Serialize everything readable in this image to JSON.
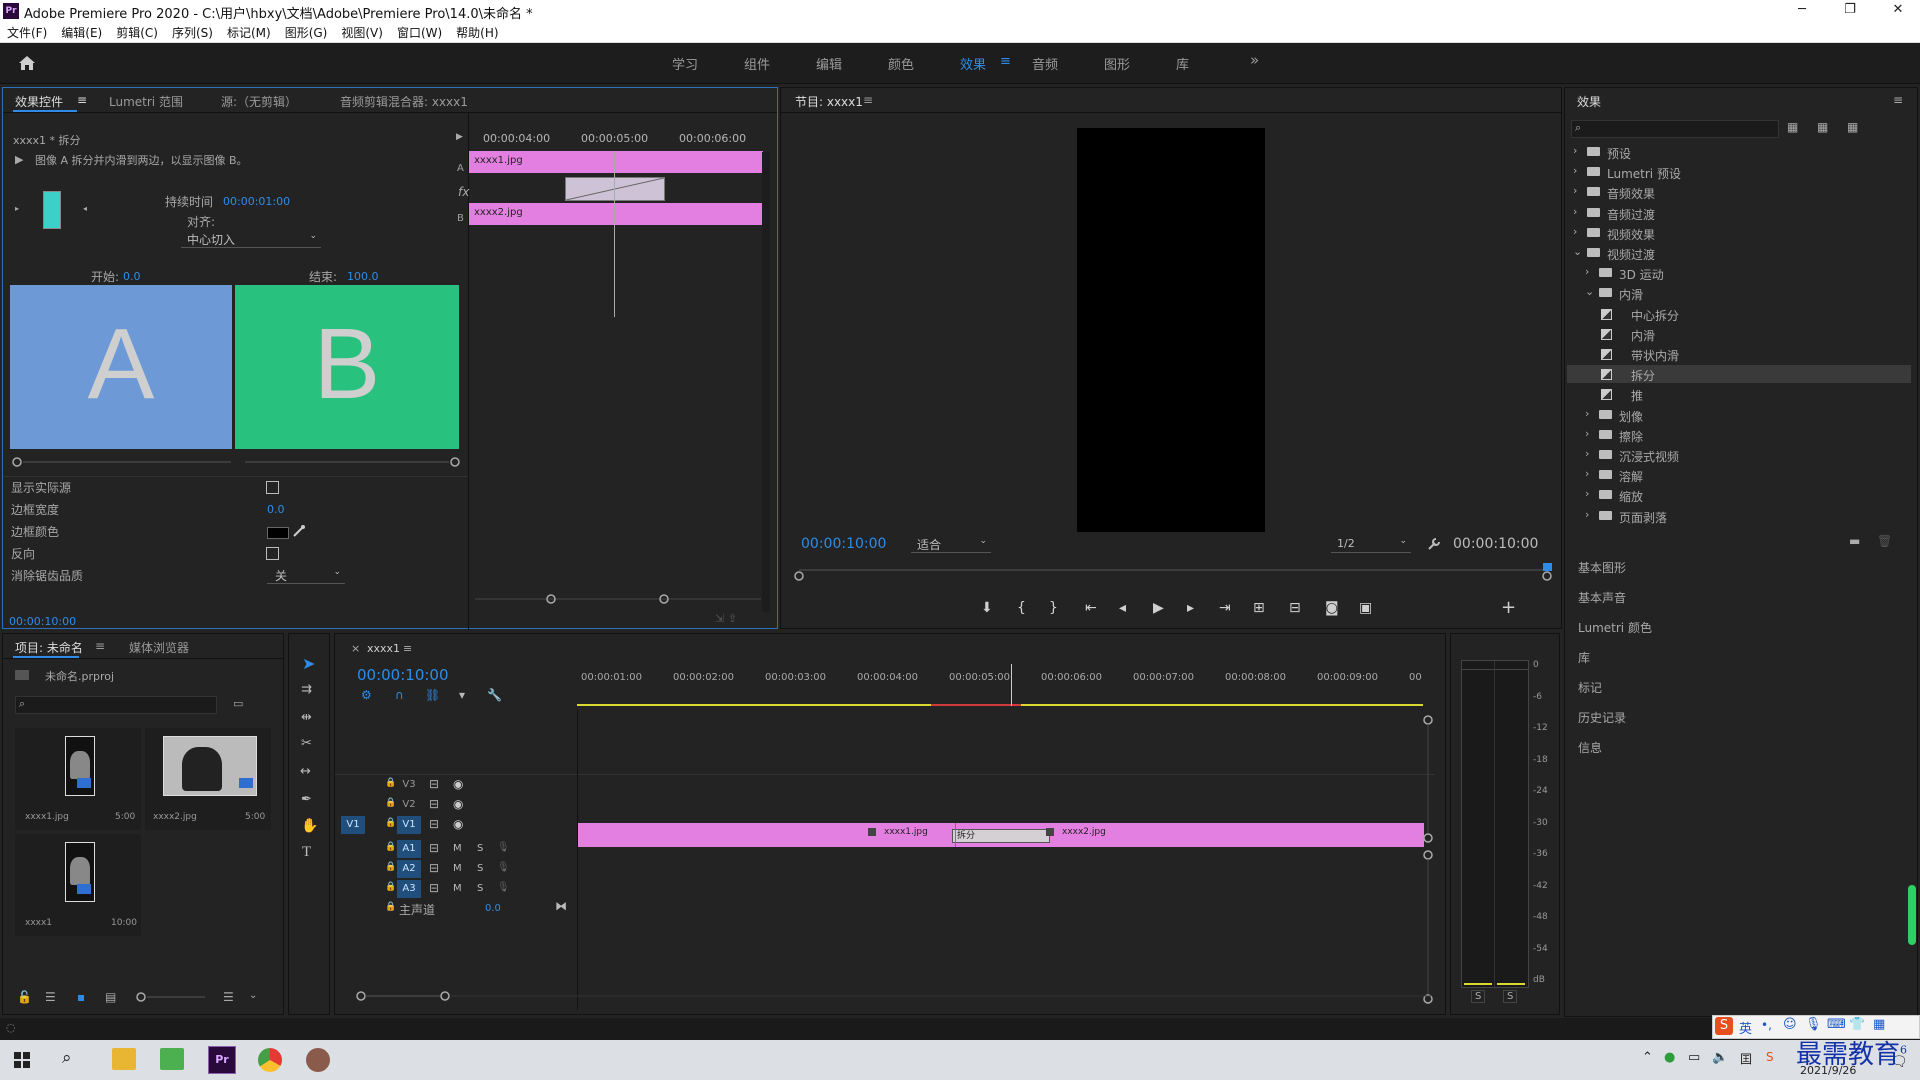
{
  "window": {
    "title": "Adobe Premiere Pro 2020 - C:\\用户\\hbxy\\文档\\Adobe\\Premiere Pro\\14.0\\未命名 *",
    "min": "─",
    "max": "❐",
    "close": "✕"
  },
  "menu": [
    "文件(F)",
    "编辑(E)",
    "剪辑(C)",
    "序列(S)",
    "标记(M)",
    "图形(G)",
    "视图(V)",
    "窗口(W)",
    "帮助(H)"
  ],
  "workspaces": [
    "学习",
    "组件",
    "编辑",
    "颜色",
    "效果",
    "音频",
    "图形",
    "库"
  ],
  "workspace_more": "»",
  "effect_controls": {
    "tabs": [
      "效果控件",
      "Lumetri 范围",
      "源:（无剪辑）",
      "音频剪辑混合器: xxxx1"
    ],
    "clip_label": "xxxx1 * 拆分",
    "description": "图像 A 拆分并内滑到两边，以显示图像 B。",
    "duration_label": "持续时间",
    "duration_value": "00:00:01:00",
    "align_label": "对齐:",
    "align_value": "中心切入",
    "start_label": "开始:",
    "start_value": "0.0",
    "end_label": "结束:",
    "end_value": "100.0",
    "letter_a": "A",
    "letter_b": "B",
    "timecodes": [
      "00:00:04:00",
      "00:00:05:00",
      "00:00:06:00"
    ],
    "track_a_clip": "xxxx1.jpg",
    "track_b_clip": "xxxx2.jpg",
    "track_a_label": "A",
    "track_b_label": "B",
    "fx_label": "fx",
    "props": [
      {
        "label": "显示实际源",
        "type": "checkbox"
      },
      {
        "label": "边框宽度",
        "type": "value",
        "value": "0.0"
      },
      {
        "label": "边框颜色",
        "type": "color"
      },
      {
        "label": "反向",
        "type": "checkbox"
      },
      {
        "label": "消除锯齿品质",
        "type": "dropdown",
        "value": "关"
      }
    ],
    "current_time": "00:00:10:00",
    "colors": {
      "a_tile": "#6d9ad6",
      "b_tile": "#29c17e",
      "clip": "#e37fe0"
    }
  },
  "program_monitor": {
    "tab": "节目: xxxx1",
    "timecode_left": "00:00:10:00",
    "fit": "适合",
    "resolution": "1/2",
    "timecode_right": "00:00:10:00"
  },
  "effects_panel": {
    "tab": "效果",
    "tree": [
      {
        "label": "预设",
        "level": 0,
        "type": "bin",
        "open": false
      },
      {
        "label": "Lumetri 预设",
        "level": 0,
        "type": "bin",
        "open": false
      },
      {
        "label": "音频效果",
        "level": 0,
        "type": "folder",
        "open": false
      },
      {
        "label": "音频过渡",
        "level": 0,
        "type": "folder",
        "open": false
      },
      {
        "label": "视频效果",
        "level": 0,
        "type": "folder",
        "open": false
      },
      {
        "label": "视频过渡",
        "level": 0,
        "type": "folder",
        "open": true
      },
      {
        "label": "3D 运动",
        "level": 1,
        "type": "folder",
        "open": false
      },
      {
        "label": "内滑",
        "level": 1,
        "type": "folder",
        "open": true
      },
      {
        "label": "中心拆分",
        "level": 2,
        "type": "fx"
      },
      {
        "label": "内滑",
        "level": 2,
        "type": "fx"
      },
      {
        "label": "带状内滑",
        "level": 2,
        "type": "fx"
      },
      {
        "label": "拆分",
        "level": 2,
        "type": "fx",
        "selected": true
      },
      {
        "label": "推",
        "level": 2,
        "type": "fx"
      },
      {
        "label": "划像",
        "level": 1,
        "type": "folder",
        "open": false
      },
      {
        "label": "擦除",
        "level": 1,
        "type": "folder",
        "open": false
      },
      {
        "label": "沉浸式视频",
        "level": 1,
        "type": "folder",
        "open": false
      },
      {
        "label": "溶解",
        "level": 1,
        "type": "folder",
        "open": false
      },
      {
        "label": "缩放",
        "level": 1,
        "type": "folder",
        "open": false
      },
      {
        "label": "页面剥落",
        "level": 1,
        "type": "folder",
        "open": false
      }
    ],
    "panels": [
      "基本图形",
      "基本声音",
      "Lumetri 颜色",
      "库",
      "标记",
      "历史记录",
      "信息"
    ]
  },
  "project": {
    "tabs": [
      "项目: 未命名",
      "媒体浏览器"
    ],
    "file": "未命名.prproj",
    "items": [
      {
        "name": "xxxx1.jpg",
        "duration": "5:00"
      },
      {
        "name": "xxxx2.jpg",
        "duration": "5:00"
      },
      {
        "name": "xxxx1",
        "duration": "10:00"
      }
    ]
  },
  "timeline": {
    "tab": "xxxx1",
    "close": "×",
    "timecode": "00:00:10:00",
    "ruler": [
      "00:00:01:00",
      "00:00:02:00",
      "00:00:03:00",
      "00:00:04:00",
      "00:00:05:00",
      "00:00:06:00",
      "00:00:07:00",
      "00:00:08:00",
      "00:00:09:00",
      "00"
    ],
    "video_tracks": [
      "V3",
      "V2",
      "V1"
    ],
    "audio_tracks": [
      "A1",
      "A2",
      "A3"
    ],
    "source_v": "V1",
    "master_label": "主声道",
    "master_value": "0.0",
    "clip1": "xxxx1.jpg",
    "clip2": "xxxx2.jpg",
    "transition": "拆分",
    "mute": "M",
    "solo": "S"
  },
  "meter": {
    "scale": [
      "0",
      "-6",
      "-12",
      "-18",
      "-24",
      "-30",
      "-36",
      "-42",
      "-48",
      "-54",
      "dB"
    ],
    "solo": [
      "S",
      "S"
    ]
  },
  "taskbar": {
    "time_date": "2021/9/26",
    "ime_lang": "英",
    "brand": "最需教育",
    "brand_small": "6"
  }
}
